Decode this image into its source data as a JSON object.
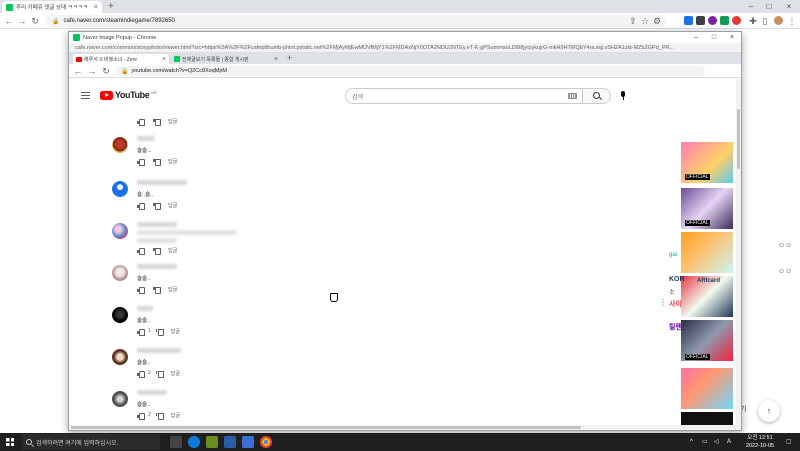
{
  "outer_browser": {
    "tab_title": "루리 카페쥬 댓글 상태 ㅋㅋㅋㅋ",
    "url": "cafe.naver.com/steamindiegame/7892650"
  },
  "popup": {
    "window_title": "Naver Image Popup - Chrome",
    "url": "cafe.naver.com/common/storyphoto/viewer.html?src=https%3A%2F%2Fcafeptthumb-phinf.pstatic.net%2FMjAyMjEwMDVfMjY1%2FMDAxNjY0OTA2NDU2NTEy.eT-K-gPSummsoLD8I8jyIzykujrG-mkH9HTMQbY4ra.wg.vSH2A1zkt-MZb2GPd_PR..."
  },
  "inner_browser": {
    "tabs": [
      {
        "title": "해루석 X 비챌소녀 - Zere"
      },
      {
        "title": "전체글보기 목록들 | 종합 게시판"
      }
    ],
    "url": "youtube.com/watch?v=Q2Cc8XoqMpM"
  },
  "youtube": {
    "logo_text": "YouTube",
    "region": "KR",
    "search_placeholder": "검색"
  },
  "comments": [
    {
      "text": "",
      "likes": "",
      "reply_label": "답글"
    },
    {
      "text": "슬슬...",
      "likes": "",
      "reply_label": "답글"
    },
    {
      "text": "슬..슬..",
      "likes": "",
      "reply_label": "답글"
    },
    {
      "text": "",
      "likes": "",
      "reply_label": "답글"
    },
    {
      "text": "슬슬..",
      "likes": "",
      "reply_label": "답글"
    },
    {
      "text": "슬슬..",
      "likes": "1",
      "reply_label": "답글"
    },
    {
      "text": "슬슬..",
      "likes": "2",
      "reply_label": "답글"
    },
    {
      "text": "슬슬..",
      "likes": "2",
      "reply_label": "답글"
    }
  ],
  "sidebar": {
    "texts": [
      "OFFICIAL",
      "OFFICIAL",
      "gai",
      "KOR",
      "ARIcard",
      "소",
      "사이",
      "릴렌",
      "OFFICIAL"
    ]
  },
  "taskbar": {
    "search_placeholder": "검색하려면 여기에 입력하십시오.",
    "time": "오전 12:51",
    "date": "2022-10-05",
    "lang": "A"
  },
  "colors": {
    "youtube_red": "#ff0000",
    "naver_green": "#03c75a",
    "taskbar": "#1f1f1f"
  }
}
